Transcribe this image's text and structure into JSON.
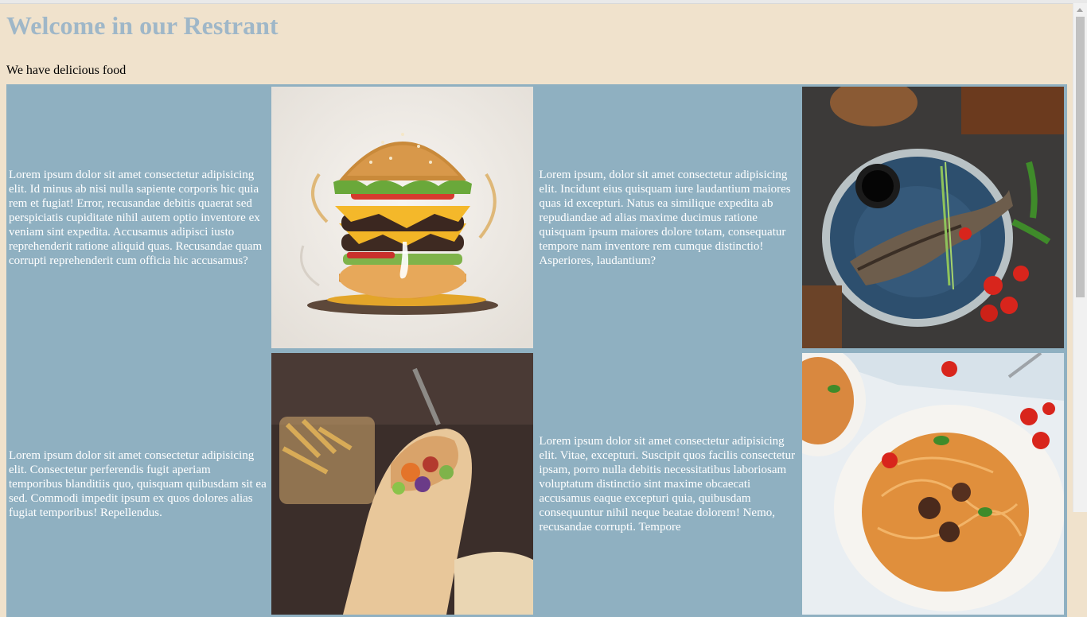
{
  "header": {
    "title": "Welcome in our Restrant",
    "subtitle": "We have delicious food"
  },
  "rows": [
    {
      "left_text": "Lorem ipsum dolor sit amet consectetur adipisicing elit. Id minus ab nisi nulla sapiente corporis hic quia rem et fugiat! Error, recusandae debitis quaerat sed perspiciatis cupiditate nihil autem optio inventore ex veniam sint expedita. Accusamus adipisci iusto reprehenderit ratione aliquid quas. Recusandae quam corrupti reprehenderit cum officia hic accusamus?",
      "image_1": "burger-image",
      "right_text": "Lorem ipsum, dolor sit amet consectetur adipisicing elit. Incidunt eius quisquam iure laudantium maiores quas id excepturi. Natus ea similique expedita ab repudiandae ad alias maxime ducimus ratione quisquam ipsum maiores dolore totam, consequatur tempore nam inventore rem cumque distinctio! Asperiores, laudantium?",
      "image_2": "fish-plate-image"
    },
    {
      "left_text": "Lorem ipsum dolor sit amet consectetur adipisicing elit. Consectetur perferendis fugit aperiam temporibus blanditiis quo, quisquam quibusdam sit ea sed. Commodi impedit ipsum ex quos dolores alias fugiat temporibus! Repellendus.",
      "image_1": "wrap-image",
      "right_text": "Lorem ipsum dolor sit amet consectetur adipisicing elit. Vitae, excepturi. Suscipit quos facilis consectetur ipsam, porro nulla debitis necessitatibus laboriosam voluptatum distinctio sint maxime obcaecati accusamus eaque excepturi quia, quibusdam consequuntur nihil neque beatae dolorem! Nemo, recusandae corrupti. Tempore",
      "image_2": "pasta-image"
    }
  ],
  "colors": {
    "page_background": "#f0e2cc",
    "table_background": "#8fb0c1",
    "title_color": "#9fb7c8",
    "cell_text": "#ffffff"
  }
}
